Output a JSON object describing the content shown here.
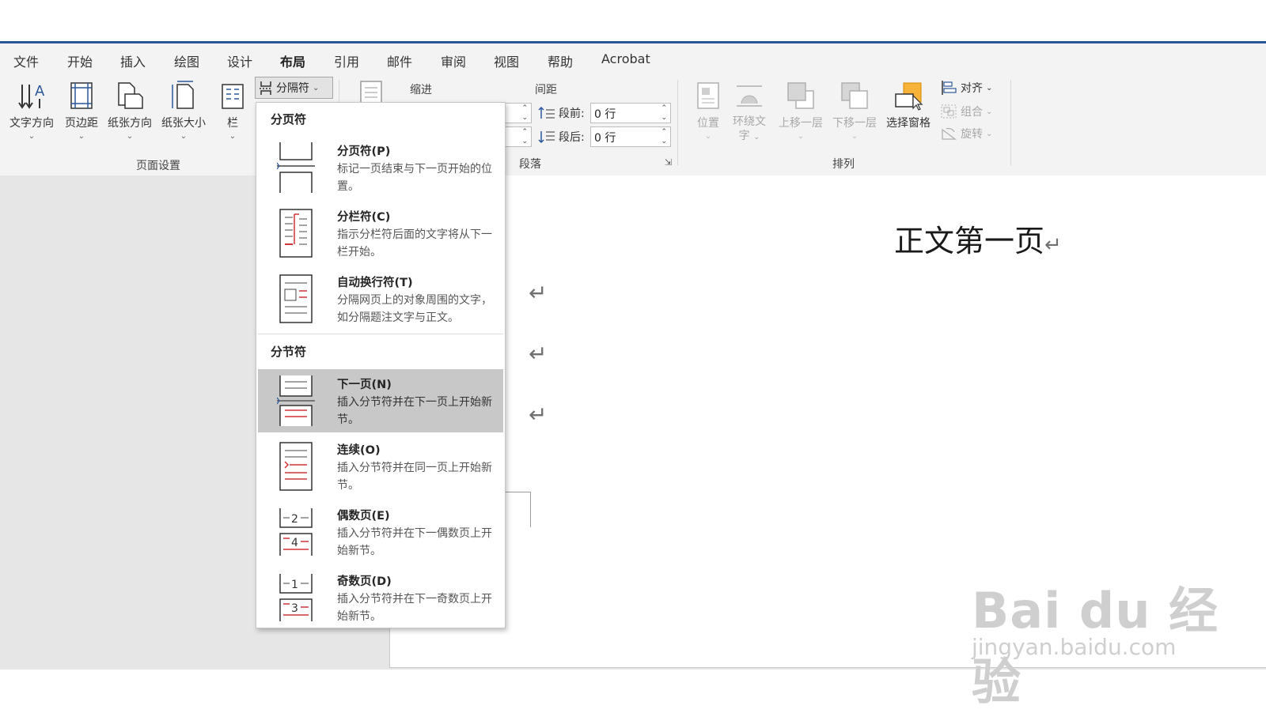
{
  "menu": [
    "文件",
    "开始",
    "插入",
    "绘图",
    "设计",
    "布局",
    "引用",
    "邮件",
    "审阅",
    "视图",
    "帮助",
    "Acrobat"
  ],
  "active_menu": "布局",
  "ribbon": {
    "page_setup": {
      "label": "页面设置",
      "text_direction": "文字方向",
      "margins": "页边距",
      "orientation": "纸张方向",
      "size": "纸张大小",
      "columns": "栏"
    },
    "breaks_button": "分隔符",
    "indent_label": "缩进",
    "spacing_label": "间距",
    "before_label": "段前:",
    "before_value": "0 行",
    "after_label": "段后:",
    "after_value": "0 行",
    "paragraph_label": "段落",
    "arrange": {
      "label": "排列",
      "position": "位置",
      "wrap_text_1": "环绕文",
      "wrap_text_2": "字",
      "bring_forward": "上移一层",
      "send_backward": "下移一层",
      "selection_pane": "选择窗格",
      "align": "对齐",
      "group": "组合",
      "rotate": "旋转"
    }
  },
  "dropdown": {
    "page_breaks_header": "分页符",
    "section_breaks_header": "分节符",
    "items": [
      {
        "title": "分页符(P)",
        "desc": "标记一页结束与下一页开始的位置。",
        "icon": "page-break-icon"
      },
      {
        "title": "分栏符(C)",
        "desc": "指示分栏符后面的文字将从下一栏开始。",
        "icon": "column-break-icon"
      },
      {
        "title": "自动换行符(T)",
        "desc": "分隔网页上的对象周围的文字，如分隔题注文字与正文。",
        "icon": "text-wrapping-icon"
      },
      {
        "title": "下一页(N)",
        "desc": "插入分节符并在下一页上开始新节。",
        "icon": "next-page-icon"
      },
      {
        "title": "连续(O)",
        "desc": "插入分节符并在同一页上开始新节。",
        "icon": "continuous-icon"
      },
      {
        "title": "偶数页(E)",
        "desc": "插入分节符并在下一偶数页上开始新节。",
        "icon": "even-page-icon"
      },
      {
        "title": "奇数页(D)",
        "desc": "插入分节符并在下一奇数页上开始新节。",
        "icon": "odd-page-icon"
      }
    ],
    "selected": "下一页(N)"
  },
  "document": {
    "heading": "正文第一页",
    "para_mark": "↵"
  },
  "watermark": {
    "logo": "Bai du 经验",
    "url": "jingyan.baidu.com"
  },
  "colors": {
    "accent": "#2b579a",
    "highlight": "#c8c8c8",
    "break_red": "#d13438"
  }
}
